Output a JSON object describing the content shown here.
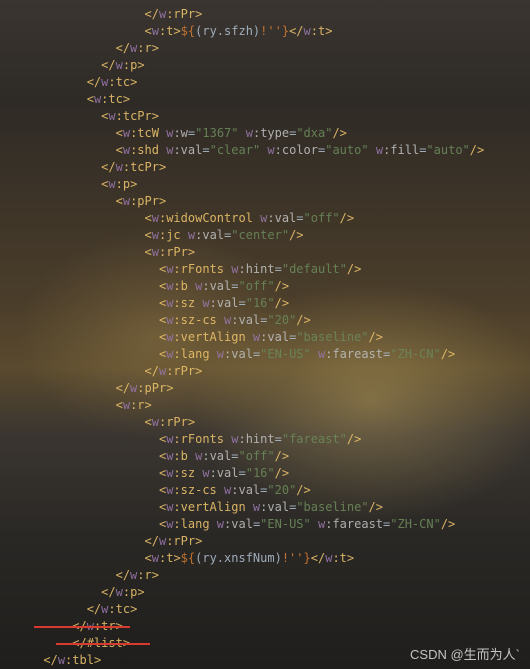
{
  "lines": [
    {
      "i": 20,
      "p": [
        "ct",
        "ns",
        "w",
        ":",
        "t",
        "rPr",
        "ct2"
      ]
    },
    {
      "i": 20,
      "raw": [
        "<",
        "w",
        ":",
        "t",
        ">",
        "${",
        "(ry.sfzh)",
        "!''",
        "}",
        "</",
        "w",
        ":",
        "t",
        ">"
      ]
    },
    {
      "i": 16,
      "p": [
        "ct",
        "ns",
        "w",
        ":",
        "t",
        "r",
        "ct2"
      ]
    },
    {
      "i": 14,
      "p": [
        "ct",
        "ns",
        "w",
        ":",
        "t",
        "p",
        "ct2"
      ]
    },
    {
      "i": 12,
      "p": [
        "ct",
        "ns",
        "w",
        ":",
        "t",
        "tc",
        "ct2"
      ]
    },
    {
      "i": 12,
      "p": [
        "ot",
        "ns",
        "w",
        ":",
        "t",
        "tc",
        "ct2"
      ]
    },
    {
      "i": 14,
      "p": [
        "ot",
        "ns",
        "w",
        ":",
        "t",
        "tcPr",
        "ct2"
      ]
    },
    {
      "i": 16,
      "attrs": {
        "tag": "tcW",
        "sc": true,
        "a": [
          [
            "w:w",
            "1367"
          ],
          [
            "w:type",
            "dxa"
          ]
        ]
      }
    },
    {
      "i": 16,
      "attrs": {
        "tag": "shd",
        "sc": true,
        "a": [
          [
            "w:val",
            "clear"
          ],
          [
            "w:color",
            "auto"
          ],
          [
            "w:fill",
            "auto"
          ]
        ]
      }
    },
    {
      "i": 14,
      "p": [
        "ct",
        "ns",
        "w",
        ":",
        "t",
        "tcPr",
        "ct2"
      ]
    },
    {
      "i": 14,
      "p": [
        "ot",
        "ns",
        "w",
        ":",
        "t",
        "p",
        "ct2"
      ]
    },
    {
      "i": 16,
      "p": [
        "ot",
        "ns",
        "w",
        ":",
        "t",
        "pPr",
        "ct2"
      ]
    },
    {
      "i": 20,
      "attrs": {
        "tag": "widowControl",
        "sc": true,
        "a": [
          [
            "w:val",
            "off"
          ]
        ]
      }
    },
    {
      "i": 20,
      "attrs": {
        "tag": "jc",
        "sc": true,
        "a": [
          [
            "w:val",
            "center"
          ]
        ]
      }
    },
    {
      "i": 20,
      "p": [
        "ot",
        "ns",
        "w",
        ":",
        "t",
        "rPr",
        "ct2"
      ]
    },
    {
      "i": 22,
      "attrs": {
        "tag": "rFonts",
        "sc": true,
        "a": [
          [
            "w:hint",
            "default"
          ]
        ]
      }
    },
    {
      "i": 22,
      "attrs": {
        "tag": "b",
        "sc": true,
        "a": [
          [
            "w:val",
            "off"
          ]
        ]
      }
    },
    {
      "i": 22,
      "attrs": {
        "tag": "sz",
        "sc": true,
        "a": [
          [
            "w:val",
            "16"
          ]
        ]
      }
    },
    {
      "i": 22,
      "attrs": {
        "tag": "sz-cs",
        "sc": true,
        "a": [
          [
            "w:val",
            "20"
          ]
        ]
      }
    },
    {
      "i": 22,
      "attrs": {
        "tag": "vertAlign",
        "sc": true,
        "a": [
          [
            "w:val",
            "baseline"
          ]
        ]
      }
    },
    {
      "i": 22,
      "attrs": {
        "tag": "lang",
        "sc": true,
        "a": [
          [
            "w:val",
            "EN-US"
          ],
          [
            "w:fareast",
            "ZH-CN"
          ]
        ]
      }
    },
    {
      "i": 20,
      "p": [
        "ct",
        "ns",
        "w",
        ":",
        "t",
        "rPr",
        "ct2"
      ]
    },
    {
      "i": 16,
      "p": [
        "ct",
        "ns",
        "w",
        ":",
        "t",
        "pPr",
        "ct2"
      ]
    },
    {
      "i": 16,
      "p": [
        "ot",
        "ns",
        "w",
        ":",
        "t",
        "r",
        "ct2"
      ]
    },
    {
      "i": 20,
      "p": [
        "ot",
        "ns",
        "w",
        ":",
        "t",
        "rPr",
        "ct2"
      ]
    },
    {
      "i": 22,
      "attrs": {
        "tag": "rFonts",
        "sc": true,
        "a": [
          [
            "w:hint",
            "fareast"
          ]
        ]
      }
    },
    {
      "i": 22,
      "attrs": {
        "tag": "b",
        "sc": true,
        "a": [
          [
            "w:val",
            "off"
          ]
        ]
      }
    },
    {
      "i": 22,
      "attrs": {
        "tag": "sz",
        "sc": true,
        "a": [
          [
            "w:val",
            "16"
          ]
        ]
      }
    },
    {
      "i": 22,
      "attrs": {
        "tag": "sz-cs",
        "sc": true,
        "a": [
          [
            "w:val",
            "20"
          ]
        ]
      }
    },
    {
      "i": 22,
      "attrs": {
        "tag": "vertAlign",
        "sc": true,
        "a": [
          [
            "w:val",
            "baseline"
          ]
        ]
      }
    },
    {
      "i": 22,
      "attrs": {
        "tag": "lang",
        "sc": true,
        "a": [
          [
            "w:val",
            "EN-US"
          ],
          [
            "w:fareast",
            "ZH-CN"
          ]
        ]
      }
    },
    {
      "i": 20,
      "p": [
        "ct",
        "ns",
        "w",
        ":",
        "t",
        "rPr",
        "ct2"
      ]
    },
    {
      "i": 20,
      "raw": [
        "<",
        "w",
        ":",
        "t",
        ">",
        "${",
        "(ry.xnsfNum)",
        "!''",
        "}",
        "</",
        "w",
        ":",
        "t",
        ">"
      ]
    },
    {
      "i": 16,
      "p": [
        "ct",
        "ns",
        "w",
        ":",
        "t",
        "r",
        "ct2"
      ]
    },
    {
      "i": 14,
      "p": [
        "ct",
        "ns",
        "w",
        ":",
        "t",
        "p",
        "ct2"
      ]
    },
    {
      "i": 12,
      "p": [
        "ct",
        "ns",
        "w",
        ":",
        "t",
        "tc",
        "ct2"
      ]
    },
    {
      "i": 10,
      "p": [
        "ct",
        "ns",
        "w",
        ":",
        "t",
        "tr",
        "ct2"
      ]
    },
    {
      "i": 10,
      "listend": "</#list>"
    },
    {
      "i": 6,
      "p": [
        "ct",
        "ns",
        "w",
        ":",
        "t",
        "tbl",
        "ct2"
      ]
    }
  ],
  "watermark": "CSDN @生而为人`"
}
